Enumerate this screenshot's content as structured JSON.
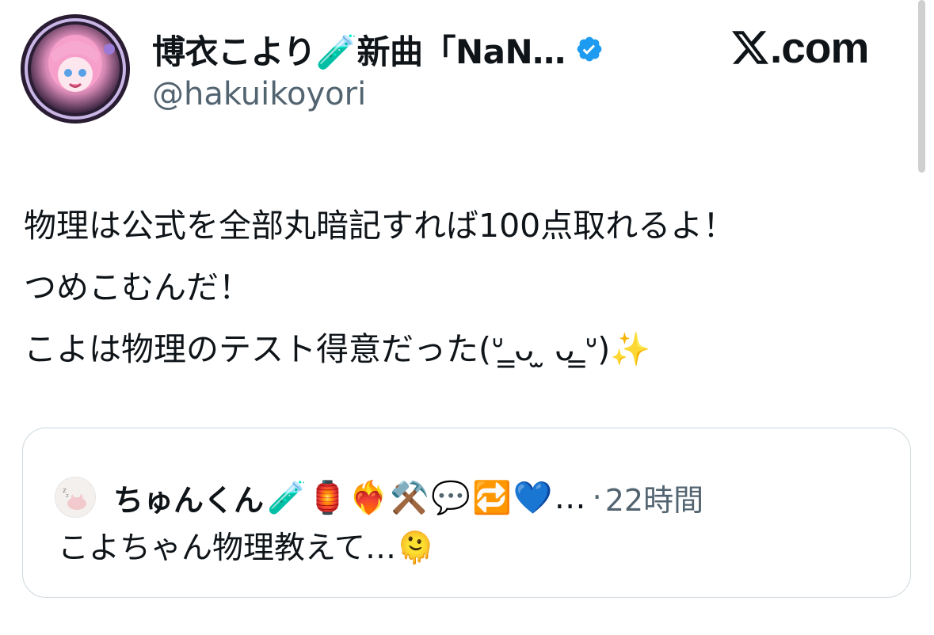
{
  "colors": {
    "text": "#0f1419",
    "secondary": "#536471",
    "verified": "#1d9bf0",
    "card_border": "#cfd9de"
  },
  "header": {
    "avatar_icon": "profile-avatar-anime-pink-hair",
    "display_name": "博衣こより🧪新曲「NaN…",
    "verified_icon": "verified-badge-icon",
    "handle": "@hakuikoyori",
    "site_logo_text": ".com",
    "site_logo_icon": "x-logo-icon"
  },
  "tweet": {
    "lines": [
      "物理は公式を全部丸暗記すれば100点取れるよ！",
      "つめこむんだ！",
      "こよは物理のテスト得意だった(ᐡ ̳ᴗ  ̫ ᴗ ̳ᐡ)✨"
    ]
  },
  "quote": {
    "avatar_icon": "sleeping-cat-avatar-icon",
    "name": "ちゅんくん",
    "name_emojis": "🧪🏮❤️‍🔥⚒️💬🔁💙…",
    "separator": "·",
    "time": "22時間",
    "text": "こよちゃん物理教えて…🫠"
  }
}
